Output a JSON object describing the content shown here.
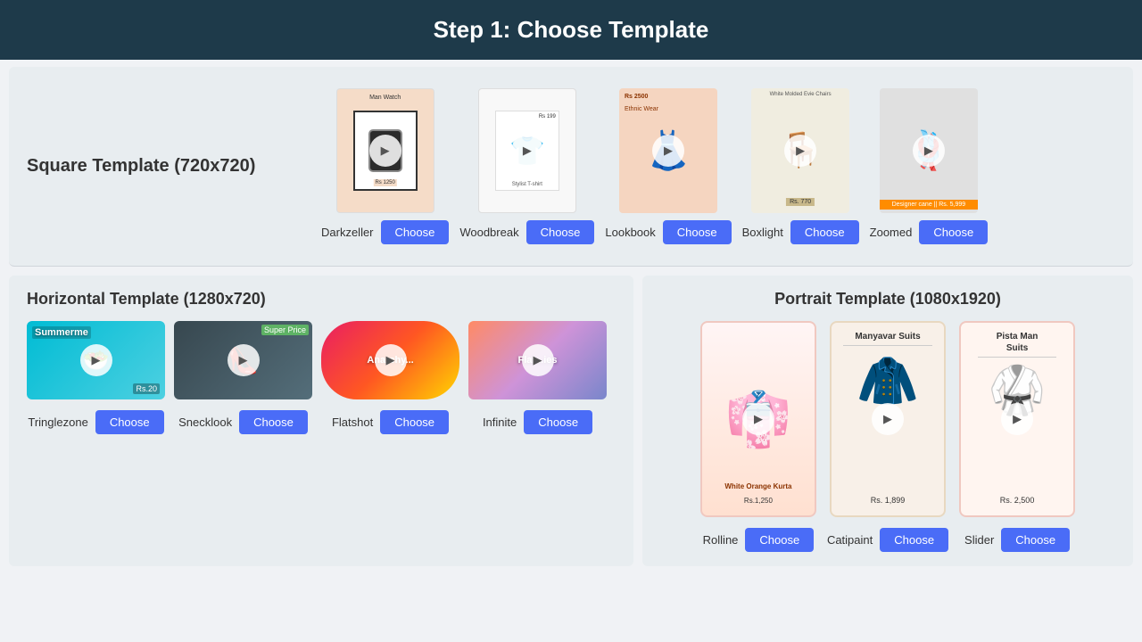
{
  "header": {
    "title": "Step 1: Choose Template"
  },
  "squareSection": {
    "label": "Square Template (720x720)",
    "templates": [
      {
        "id": "darkzeller",
        "name": "Darkzeller",
        "choose_label": "Choose",
        "bg": "peach"
      },
      {
        "id": "woodbreak",
        "name": "Woodbreak",
        "choose_label": "Choose",
        "bg": "white"
      },
      {
        "id": "lookbook",
        "name": "Lookbook",
        "choose_label": "Choose",
        "bg": "pink"
      },
      {
        "id": "boxlight",
        "name": "Boxlight",
        "choose_label": "Choose",
        "bg": "cream"
      },
      {
        "id": "zoomed",
        "name": "Zoomed",
        "choose_label": "Choose",
        "bg": "gray"
      }
    ]
  },
  "horizontalSection": {
    "label": "Horizontal Template (1280x720)",
    "templates": [
      {
        "id": "tringlezone",
        "name": "Tringlezone",
        "choose_label": "Choose"
      },
      {
        "id": "snecklook",
        "name": "Snecklook",
        "choose_label": "Choose"
      },
      {
        "id": "flatshot",
        "name": "Flatshot",
        "choose_label": "Choose"
      },
      {
        "id": "infinite",
        "name": "Infinite",
        "choose_label": "Choose"
      }
    ]
  },
  "portraitSection": {
    "label": "Portrait Template (1080x1920)",
    "templates": [
      {
        "id": "rolline",
        "name": "Rolline",
        "choose_label": "Choose",
        "caption": "White Orange Kurta",
        "price": "Rs.1,250"
      },
      {
        "id": "catipaint",
        "name": "Catipaint",
        "choose_label": "Choose",
        "caption": "Manyavar Suits",
        "price": "Rs. 1,899"
      },
      {
        "id": "slider",
        "name": "Slider",
        "choose_label": "Choose",
        "caption": "Pista Man Suits",
        "price": "Rs. 2,500"
      }
    ]
  }
}
